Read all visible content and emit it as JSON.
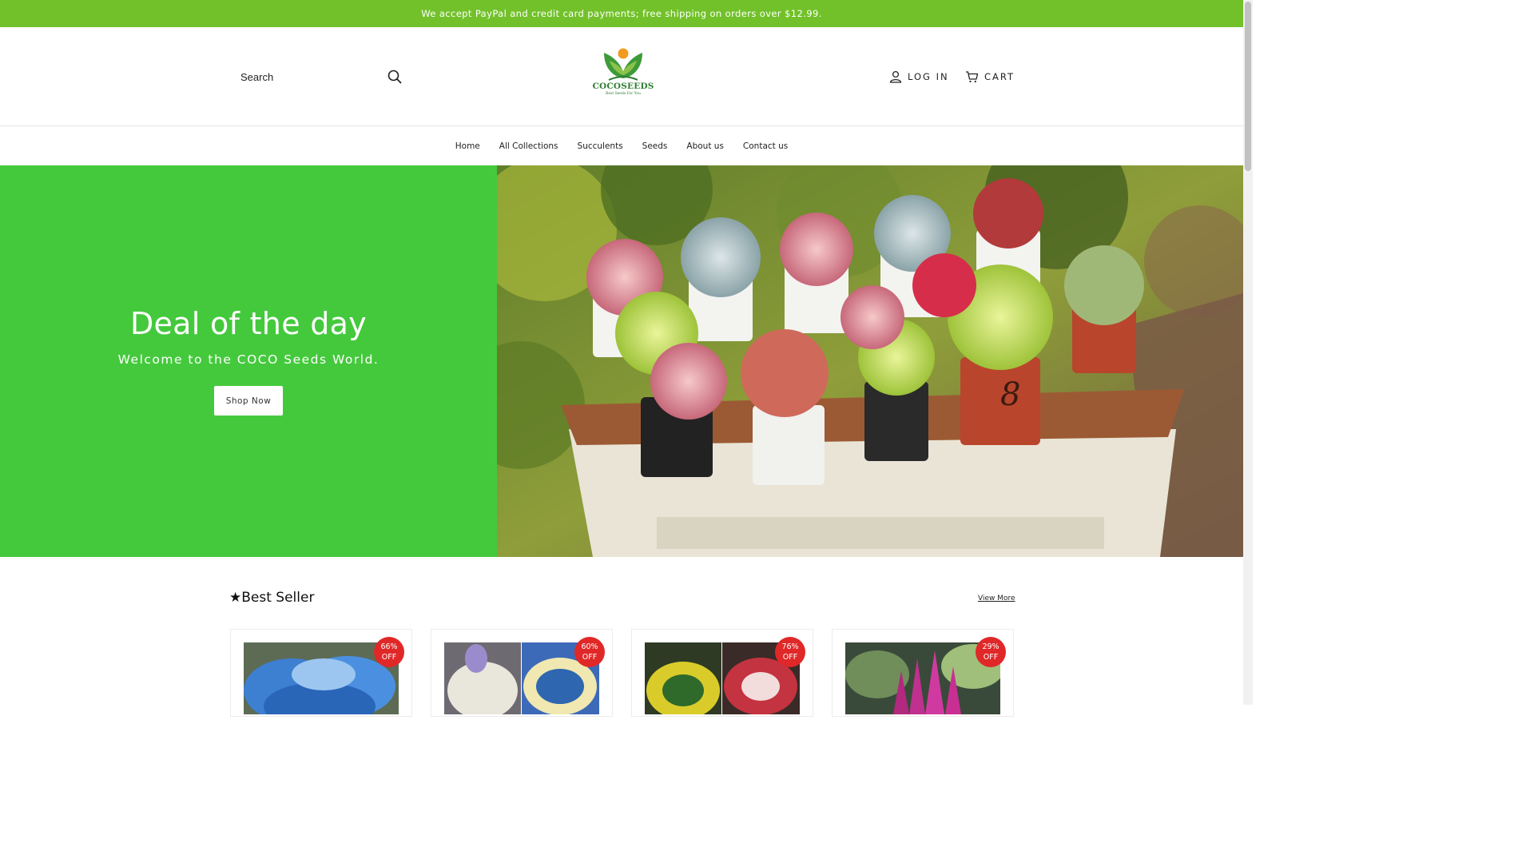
{
  "announcement": "We accept PayPal and credit card payments; free shipping on orders over $12.99.",
  "header": {
    "search_placeholder": "Search",
    "logo_name": "COCOSEEDS",
    "logo_tagline": "Best Seeds For You",
    "login_label": "LOG IN",
    "cart_label": "CART"
  },
  "nav": {
    "items": [
      {
        "label": "Home"
      },
      {
        "label": "All Collections"
      },
      {
        "label": "Succulents"
      },
      {
        "label": "Seeds"
      },
      {
        "label": "About us"
      },
      {
        "label": "Contact us"
      }
    ]
  },
  "hero": {
    "title": "Deal of the day",
    "subtitle": "Welcome to the COCO Seeds World.",
    "button_label": "Shop Now"
  },
  "best_seller": {
    "title": "★Best Seller",
    "view_more": "View More",
    "products": [
      {
        "discount": "66%",
        "off": "OFF"
      },
      {
        "discount": "60%",
        "off": "OFF"
      },
      {
        "discount": "76%",
        "off": "OFF"
      },
      {
        "discount": "29%",
        "off": "OFF"
      }
    ]
  },
  "colors": {
    "announcement_bg": "#72c12a",
    "hero_bg": "#44c93c",
    "badge": "#e02828"
  }
}
